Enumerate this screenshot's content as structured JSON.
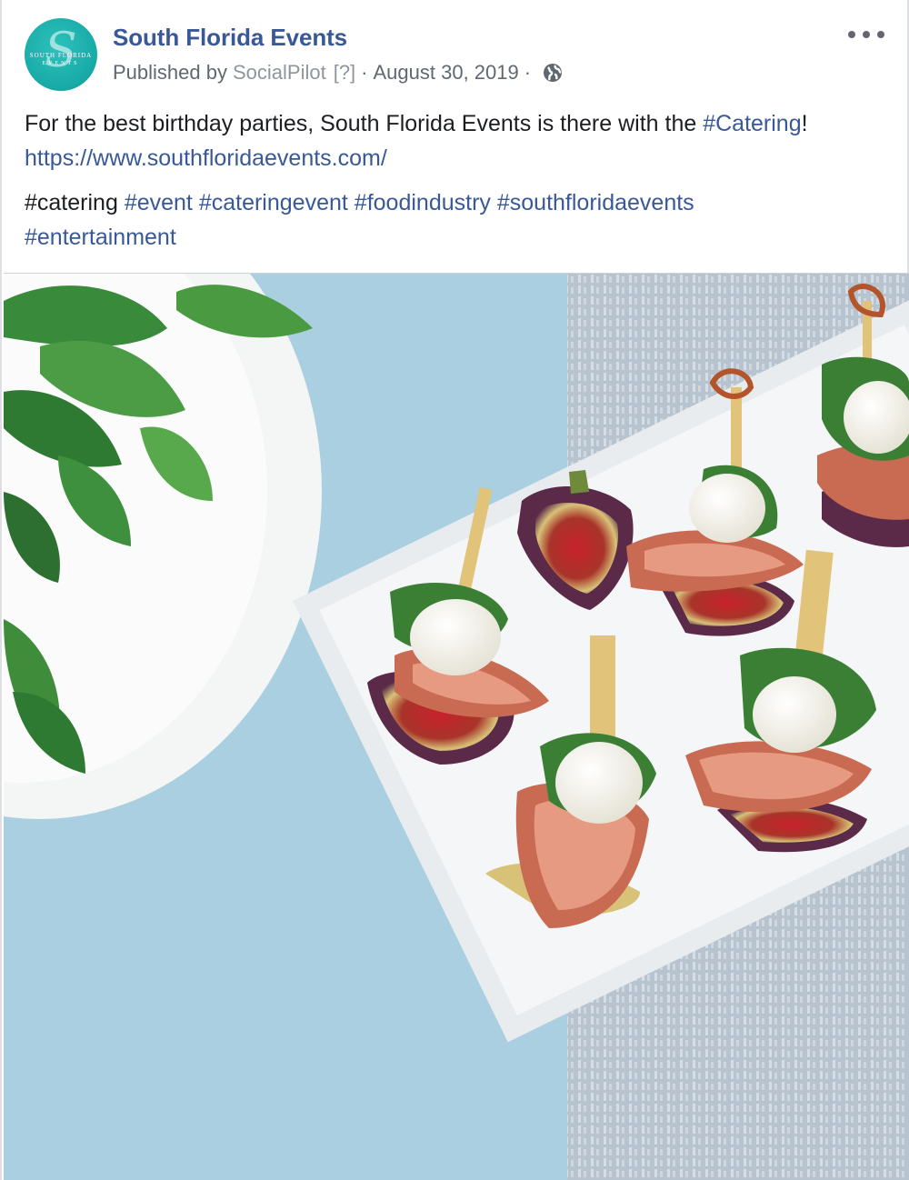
{
  "post": {
    "page_name": "South Florida Events",
    "published_by_label": "Published by",
    "publisher": "SocialPilot",
    "help_marker": "[?]",
    "separator": "·",
    "date": "August 30, 2019",
    "privacy_icon": "globe-icon",
    "more_icon": "more-options-icon",
    "avatar": {
      "monogram": "S",
      "line1": "SOUTH FLORIDA",
      "line2": "EVENTS"
    },
    "body": {
      "line1_text": "For the best birthday parties, South Florida Events is there with the ",
      "line1_hashtag": "#Catering",
      "line1_end": "!",
      "link": "https://www.southfloridaevents.com/"
    },
    "hashtags": {
      "plain": "#catering",
      "linked": [
        "#event",
        "#cateringevent",
        "#foodindustry",
        "#southfloridaevents",
        "#entertainment"
      ]
    },
    "image": {
      "alt_icon": "catering-photo"
    }
  },
  "colors": {
    "link": "#385898",
    "text": "#1c1e21",
    "meta": "#616770",
    "avatar": "#17a9a5",
    "tablecloth": "#a9cfe0"
  }
}
